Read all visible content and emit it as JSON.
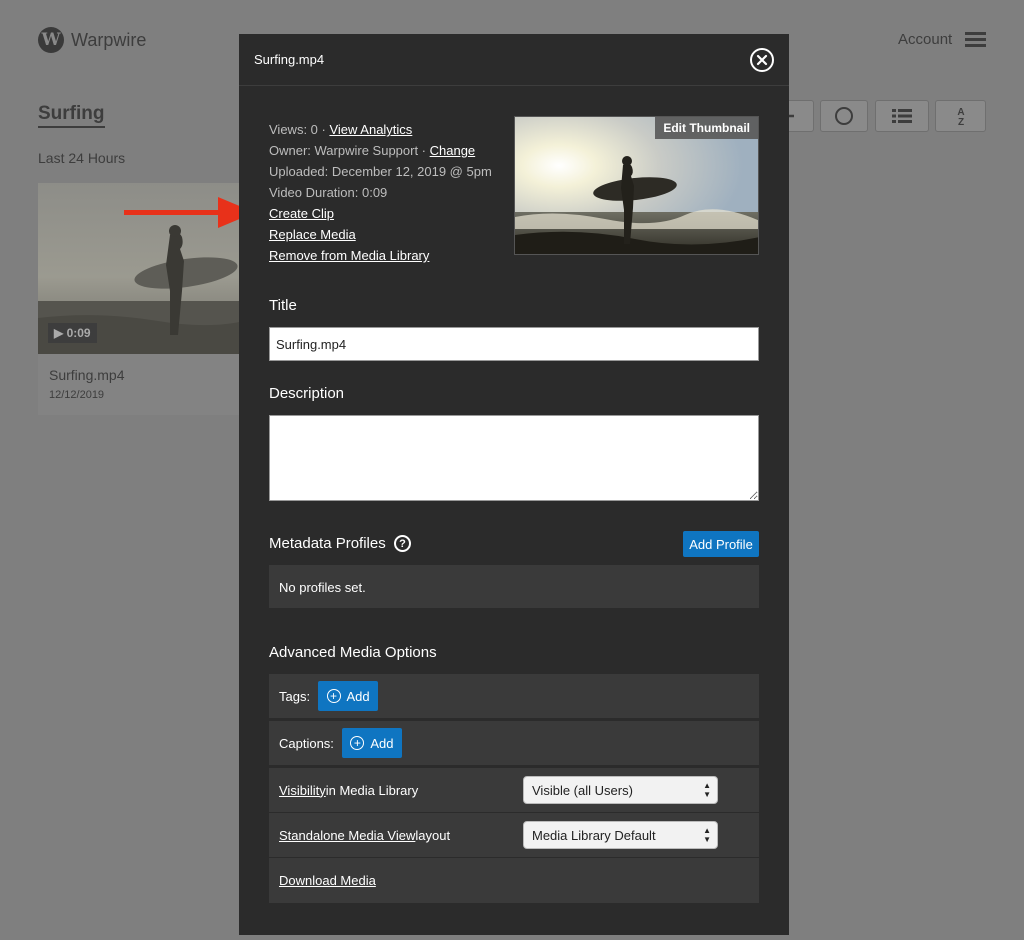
{
  "app": {
    "brand": "Warpwire",
    "logo_letter": "W",
    "account_label": "Account"
  },
  "library": {
    "title": "Surfing",
    "subtitle": "Last 24 Hours",
    "card": {
      "duration": "▶ 0:09",
      "name": "Surfing.mp4",
      "date": "12/12/2019"
    }
  },
  "modal": {
    "title": "Surfing.mp4",
    "info": {
      "views_text": "Views: 0 · ",
      "view_analytics": "View Analytics",
      "owner_text": "Owner: Warpwire Support · ",
      "change_link": "Change",
      "uploaded": "Uploaded: December 12, 2019 @ 5pm",
      "duration": "Video Duration: 0:09",
      "create_clip": "Create Clip",
      "replace_media": "Replace Media",
      "remove_media": "Remove from Media Library"
    },
    "edit_thumbnail": "Edit Thumbnail",
    "title_label": "Title",
    "title_value": "Surfing.mp4",
    "description_label": "Description",
    "description_value": "",
    "metadata_label": "Metadata Profiles",
    "help_glyph": "?",
    "add_profile": "Add Profile",
    "no_profiles": "No profiles set.",
    "advanced_label": "Advanced Media Options",
    "tags_label": "Tags:",
    "captions_label": "Captions:",
    "add_label": "Add",
    "visibility_link": "Visibility",
    "visibility_rest": " in Media Library",
    "visibility_value": "Visible (all Users)",
    "standalone_link": "Standalone Media View",
    "standalone_rest": " layout",
    "standalone_value": "Media Library Default",
    "download_media": "Download Media"
  },
  "colors": {
    "overlay_bg": "#7f7f7f",
    "modal_bg": "#2b2b2b",
    "panel_bg": "#3a3a3a",
    "accent_blue": "#0f75c1",
    "arrow_red": "#e8311a"
  }
}
